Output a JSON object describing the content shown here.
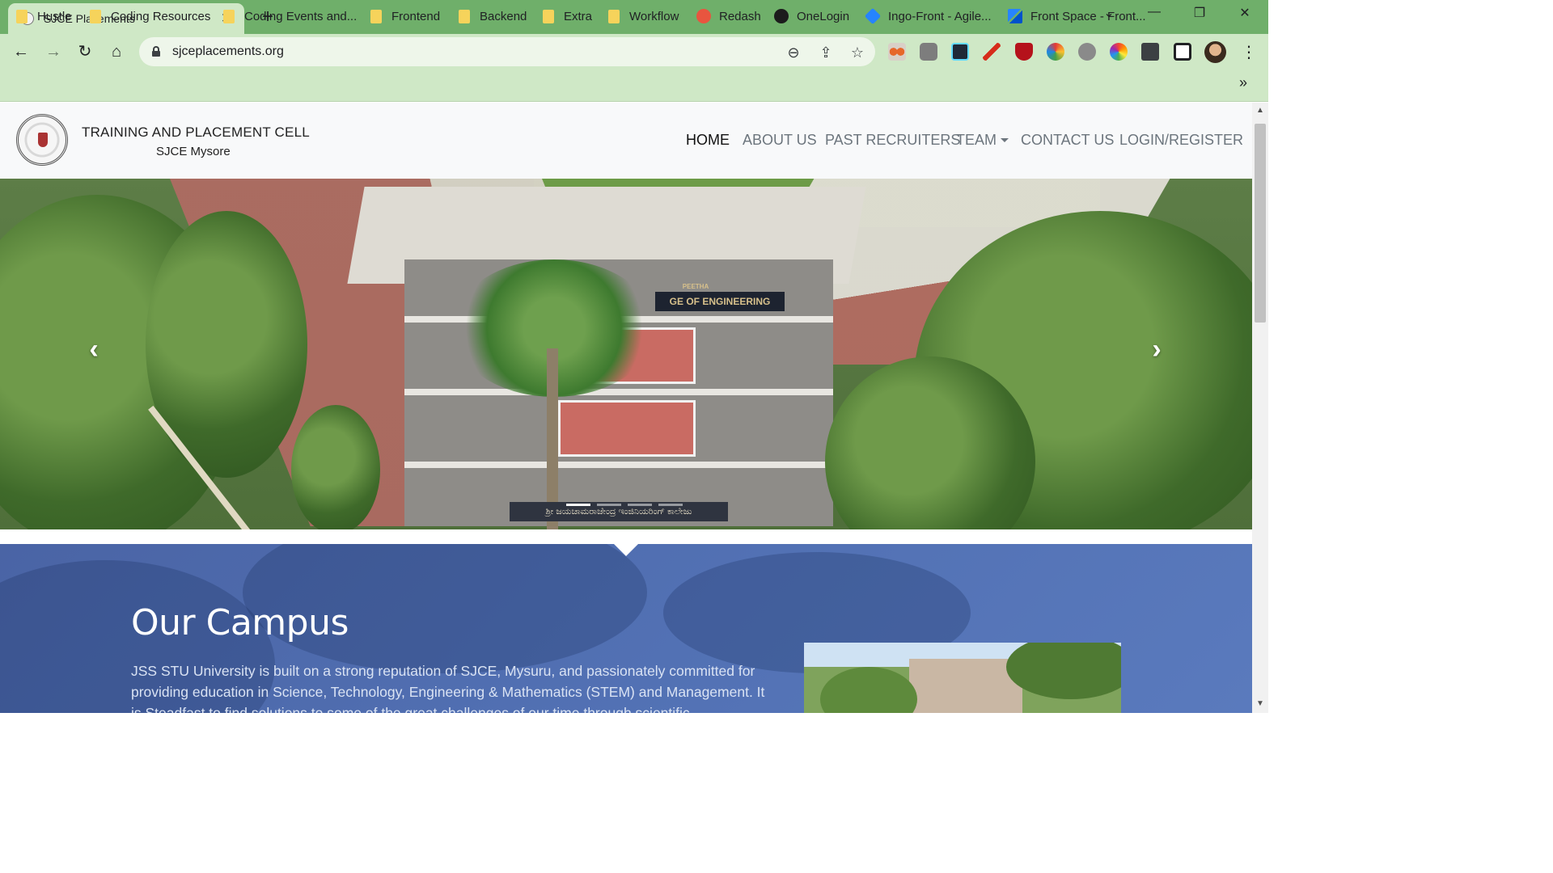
{
  "browser": {
    "tab_title": "SJCE Placements",
    "tab_close": "✕",
    "new_tab": "+",
    "url": "sjceplacements.org",
    "window_controls": {
      "tab_search": "⌄",
      "minimize": "—",
      "restore": "❐",
      "close": "✕"
    },
    "nav_icons": {
      "back": "←",
      "forward": "→",
      "reload": "↻",
      "home": "⌂"
    },
    "omnibox_icons": {
      "zoom": "⊖",
      "share": "⇪",
      "bookmark": "☆"
    },
    "extensions": [
      "glasses-extension-icon",
      "camera-extension-icon",
      "react-devtools-icon",
      "pen-extension-icon",
      "ublock-origin-icon",
      "color-globe-icon",
      "bug-extension-icon",
      "color-wheel-icon",
      "puzzle-extensions-icon",
      "sidebar-icon",
      "profile-avatar"
    ],
    "menu_icon": "⋮",
    "bookmarks": [
      {
        "label": "Hustle",
        "icon": "folder"
      },
      {
        "label": "Coding Resources",
        "icon": "folder"
      },
      {
        "label": "Coding Events and...",
        "icon": "folder"
      },
      {
        "label": "Frontend",
        "icon": "folder"
      },
      {
        "label": "Backend",
        "icon": "folder"
      },
      {
        "label": "Extra",
        "icon": "folder"
      },
      {
        "label": "Workflow",
        "icon": "folder"
      },
      {
        "label": "Redash",
        "icon": "redash"
      },
      {
        "label": "OneLogin",
        "icon": "onelogin"
      },
      {
        "label": "Ingo-Front - Agile...",
        "icon": "jira"
      },
      {
        "label": "Front Space - Front...",
        "icon": "confluence"
      }
    ],
    "bookmarks_overflow": "»",
    "colors": {
      "tabstrip": "#6faf6a",
      "toolbar": "#cfe8c6"
    }
  },
  "site": {
    "brand_title": "TRAINING AND PLACEMENT CELL",
    "brand_subtitle": "SJCE Mysore",
    "menu": {
      "home": "HOME",
      "about": "ABOUT US",
      "recruiters": "PAST RECRUITERS",
      "team": "TEAM",
      "contact": "CONTACT US",
      "login": "LOGIN/REGISTER"
    },
    "hero": {
      "building_sign": "GE OF ENGINEERING",
      "building_top_sign": "PEETHA",
      "kannada_sign": "ಶ್ರೀ ಜಯಚಾಮರಾಜೇಂದ್ರ ಇಂಜಿನಿಯರಿಂಗ್ ಕಾಲೇಜು",
      "prev": "‹",
      "next": "›",
      "slides": 4,
      "active_slide": 1
    },
    "campus": {
      "heading": "Our Campus",
      "text": "JSS STU University is built on a strong reputation of SJCE, Mysuru, and passionately committed for providing education in Science, Technology, Engineering & Mathematics (STEM) and Management. It is Steadfast to find solutions to some of the great challenges of our time through scientific"
    },
    "colors": {
      "campus_bg": "#5271b4",
      "nav_bg": "#f8f9fa",
      "menu_inactive": "#6c757d"
    }
  }
}
